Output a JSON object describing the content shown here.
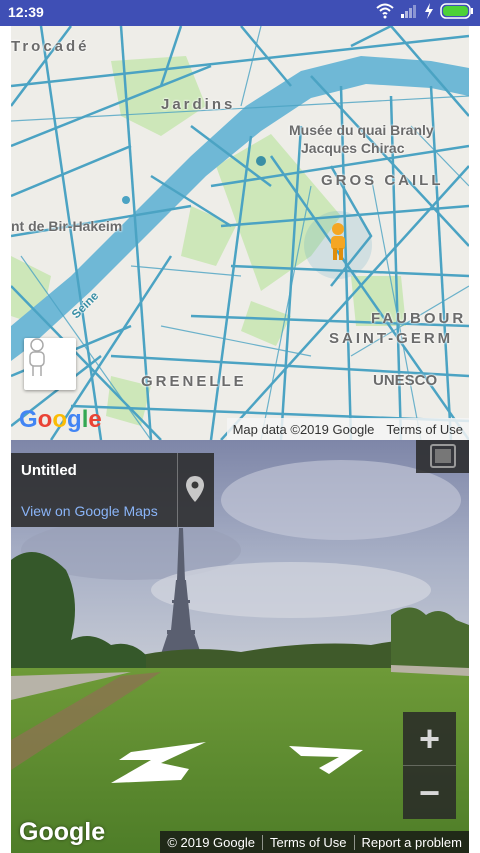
{
  "status_bar": {
    "time": "12:39",
    "icons": [
      "wifi-icon",
      "signal-icon",
      "charging-icon",
      "battery-icon"
    ],
    "background": "#3f4fb5",
    "battery_color": "#4cd137"
  },
  "map": {
    "place_labels": [
      {
        "id": "trocadero",
        "text": "Trocadé"
      },
      {
        "id": "jardins",
        "text": "Jardins"
      },
      {
        "id": "musee",
        "text": "Musée du quai Branly"
      },
      {
        "id": "jacques",
        "text": "Jacques Chirac"
      },
      {
        "id": "gros-caillou",
        "text": "GROS CAILL"
      },
      {
        "id": "bir-hakeim",
        "text": "nt de Bir-Hakeim"
      },
      {
        "id": "faubourg",
        "text": "FAUBOUR"
      },
      {
        "id": "saint-germ",
        "text": "SAINT-GERM"
      },
      {
        "id": "grenelle",
        "text": "GRENELLE"
      },
      {
        "id": "unesco",
        "text": "UNESCO"
      },
      {
        "id": "seine",
        "text": "Seine"
      }
    ],
    "google_logo_letters": [
      "G",
      "o",
      "o",
      "g",
      "l",
      "e"
    ],
    "logo_colors": [
      "#4285f4",
      "#ea4335",
      "#fbbc05",
      "#4285f4",
      "#34a853",
      "#ea4335"
    ],
    "attribution": {
      "map_data": "Map data ©2019 Google",
      "terms": "Terms of Use"
    },
    "street_line_color": "#4ba3c3",
    "park_color": "#cde7b9",
    "water_color": "#5fb0cf",
    "pegman_color": "#f5a623"
  },
  "street_view": {
    "title": "Untitled",
    "link": "View on Google Maps",
    "google_logo": "Google",
    "zoom_in": "+",
    "zoom_out": "−",
    "footer": {
      "copyright": "© 2019 Google",
      "terms": "Terms of Use",
      "report": "Report a problem"
    }
  }
}
